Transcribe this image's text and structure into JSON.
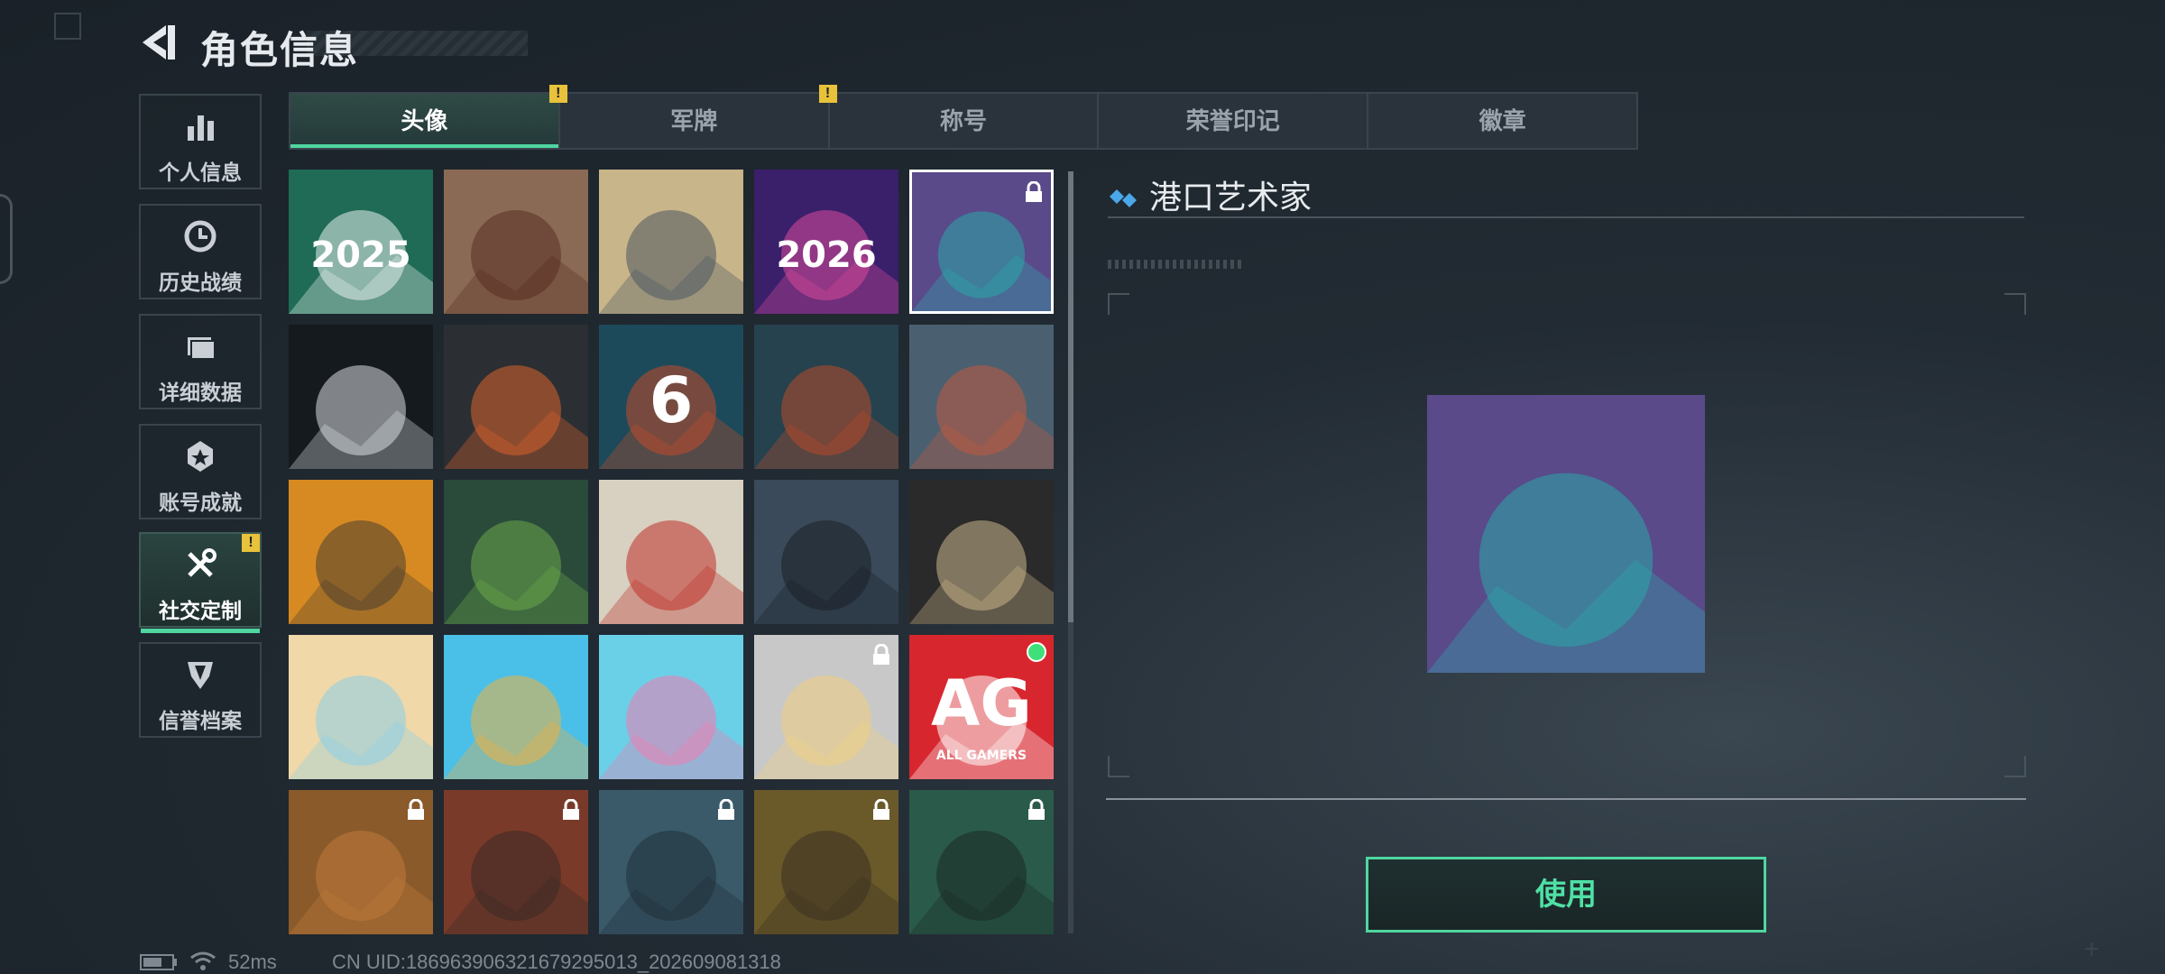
{
  "header": {
    "title": "角色信息"
  },
  "sidebar": {
    "items": [
      {
        "label": "个人信息",
        "icon": "bar-chart-icon"
      },
      {
        "label": "历史战绩",
        "icon": "clock-icon"
      },
      {
        "label": "详细数据",
        "icon": "folder-icon"
      },
      {
        "label": "账号成就",
        "icon": "achievement-icon"
      },
      {
        "label": "社交定制",
        "icon": "tools-icon",
        "active": true,
        "warning": "!"
      },
      {
        "label": "信誉档案",
        "icon": "reputation-icon"
      }
    ]
  },
  "tabs": [
    {
      "label": "头像",
      "active": true,
      "warning": "!"
    },
    {
      "label": "军牌",
      "warning": "!"
    },
    {
      "label": "称号"
    },
    {
      "label": "荣誉印记"
    },
    {
      "label": "徽章"
    }
  ],
  "avatars": [
    {
      "name": "snowman-2025",
      "text": "2025",
      "colors": [
        "#1f6b55",
        "#e8f0ee"
      ]
    },
    {
      "name": "scales-emblem",
      "colors": [
        "#8a6a55",
        "#5a2e22"
      ]
    },
    {
      "name": "mountain-soldier",
      "colors": [
        "#c9b58a",
        "#4a5560"
      ]
    },
    {
      "name": "fireworks-2026",
      "text": "2026",
      "colors": [
        "#3a1f6b",
        "#d84a9a"
      ]
    },
    {
      "name": "voyager-graffiti",
      "selected": true,
      "locked": true,
      "colors": [
        "#5a4a8a",
        "#2aa8a8"
      ]
    },
    {
      "name": "ghost-bars",
      "colors": [
        "#151a1f",
        "#d8dde0"
      ]
    },
    {
      "name": "weapons-cross",
      "colors": [
        "#2b2f33",
        "#d9622a"
      ]
    },
    {
      "name": "rainbow-six",
      "text": "6",
      "colors": [
        "#1d4a5a",
        "#c24a2a"
      ]
    },
    {
      "name": "crossed-swords",
      "colors": [
        "#25424e",
        "#b84a2a"
      ]
    },
    {
      "name": "rook-tower",
      "colors": [
        "#4a6070",
        "#c05a40"
      ]
    },
    {
      "name": "armored-beast",
      "colors": [
        "#d88a22",
        "#4a4030"
      ]
    },
    {
      "name": "green-soldier",
      "colors": [
        "#2a4a3a",
        "#6aa84a"
      ]
    },
    {
      "name": "plum-blossom",
      "colors": [
        "#d8d0c0",
        "#c0302a"
      ]
    },
    {
      "name": "operator-rifle",
      "colors": [
        "#3a4a5a",
        "#1a2028"
      ]
    },
    {
      "name": "treasure-map",
      "colors": [
        "#2a2a2a",
        "#c8b48a"
      ]
    },
    {
      "name": "beach-girl",
      "colors": [
        "#f0d8a8",
        "#8ad0e8"
      ]
    },
    {
      "name": "surf-boy",
      "colors": [
        "#4ac0e8",
        "#f0b040"
      ]
    },
    {
      "name": "flamingo-float",
      "colors": [
        "#6ad0e8",
        "#f07ab0"
      ]
    },
    {
      "name": "reading-girl",
      "locked": true,
      "colors": [
        "#c8c8c8",
        "#f0d080"
      ]
    },
    {
      "name": "all-gamers",
      "text": "AG",
      "subtext": "ALL GAMERS",
      "dot": true,
      "colors": [
        "#d8262e",
        "#ffffff"
      ]
    },
    {
      "name": "diver-helmet",
      "locked": true,
      "colors": [
        "#8a5a2a",
        "#c07a3a"
      ]
    },
    {
      "name": "cap-operator",
      "locked": true,
      "colors": [
        "#7a3a2a",
        "#3a2a25"
      ]
    },
    {
      "name": "pilot-headset",
      "locked": true,
      "colors": [
        "#3a5a6a",
        "#1f2f38"
      ]
    },
    {
      "name": "bald-operator",
      "locked": true,
      "colors": [
        "#6a5a2a",
        "#3a3020"
      ]
    },
    {
      "name": "headset-operator",
      "locked": true,
      "colors": [
        "#2a5a4a",
        "#1a2a25"
      ]
    }
  ],
  "detail": {
    "title": "港口艺术家",
    "preview": "voyager-graffiti"
  },
  "use_button": "使用",
  "footer": {
    "ping": "52ms",
    "uid": "CN UID:186963906321679295013_202609081318"
  }
}
